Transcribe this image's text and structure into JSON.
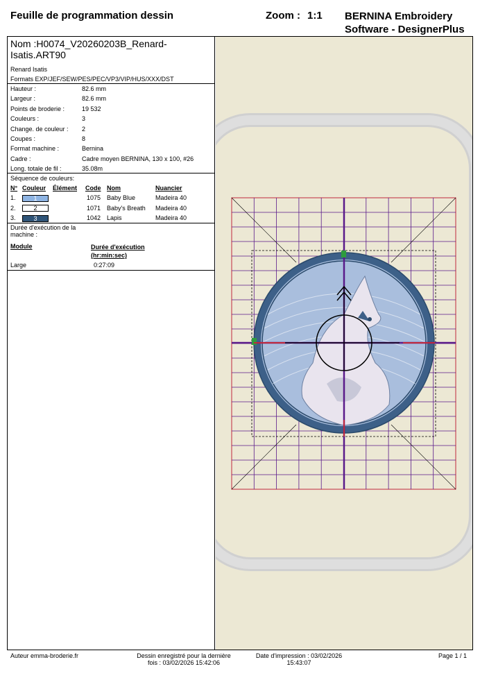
{
  "header": {
    "title": "Feuille de programmation dessin",
    "zoom_label": "Zoom :",
    "zoom_value": "1:1",
    "brand_line1": "BERNINA Embroidery",
    "brand_line2": "Software - DesignerPlus"
  },
  "design": {
    "name_line1": "Nom :H0074_V20260203B_Renard-",
    "name_line2": "Isatis.ART90",
    "subtitle": "Renard Isatis",
    "formats": "Formats EXP/JEF/SEW/PES/PEC/VP3/VIP/HUS/XXX/DST"
  },
  "properties": [
    {
      "label": "Hauteur :",
      "value": "82.6 mm"
    },
    {
      "label": "Largeur :",
      "value": "82.6 mm"
    },
    {
      "label": "Points de broderie :",
      "value": "19 532"
    },
    {
      "label": "Couleurs :",
      "value": "3"
    },
    {
      "label": "Change. de couleur :",
      "value": "2"
    },
    {
      "label": "Coupes :",
      "value": "8"
    },
    {
      "label": "Format machine :",
      "value": "Bernina"
    },
    {
      "label": "Cadre :",
      "value": "Cadre moyen BERNINA, 130 x 100, #26"
    },
    {
      "label": "Long. totale de fil :",
      "value": "35.08m"
    }
  ],
  "color_sequence": {
    "title": "Séquence de couleurs:",
    "headers": {
      "num": "N°",
      "color": "Couleur",
      "element": "Élément",
      "code": "Code",
      "name": "Nom",
      "chart": "Nuancier"
    },
    "rows": [
      {
        "num": "1.",
        "swatch_label": "1",
        "swatch_color": "#8eb4e3",
        "text_color": "#ffffff",
        "code": "1075",
        "name": "Baby Blue",
        "chart": "Madeira 40"
      },
      {
        "num": "2.",
        "swatch_label": "2",
        "swatch_color": "#ffffff",
        "text_color": "#000000",
        "code": "1071",
        "name": "Baby's Breath",
        "chart": "Madeira 40"
      },
      {
        "num": "3.",
        "swatch_label": "3",
        "swatch_color": "#2f5478",
        "text_color": "#ffffff",
        "code": "1042",
        "name": "Lapis",
        "chart": "Madeira 40"
      }
    ]
  },
  "runtime": {
    "title_line1": "Durée d'exécution de la",
    "title_line2": "machine :",
    "module_header": "Module",
    "duration_header_line1": "Durée d'exécution",
    "duration_header_line2": "(hr:min:sec)",
    "module": "Large",
    "duration": "0:27:09"
  },
  "footer": {
    "author": "Auteur emma-broderie.fr",
    "saved_line1": "Dessin enregistré pour la dernière",
    "saved_line2": "fois : 03/02/2026 15:42:06",
    "print_line1": "Date d'impression : 03/02/2026",
    "print_line2": "15:43:07",
    "page": "Page 1 / 1"
  },
  "colors": {
    "background": "#ece8d4",
    "hoop": "#d3d3d3",
    "grid_outer": "#c0283c",
    "grid_inner": "#5a1a8a",
    "ring": "#3d6088",
    "fill": "#a9bedd"
  }
}
